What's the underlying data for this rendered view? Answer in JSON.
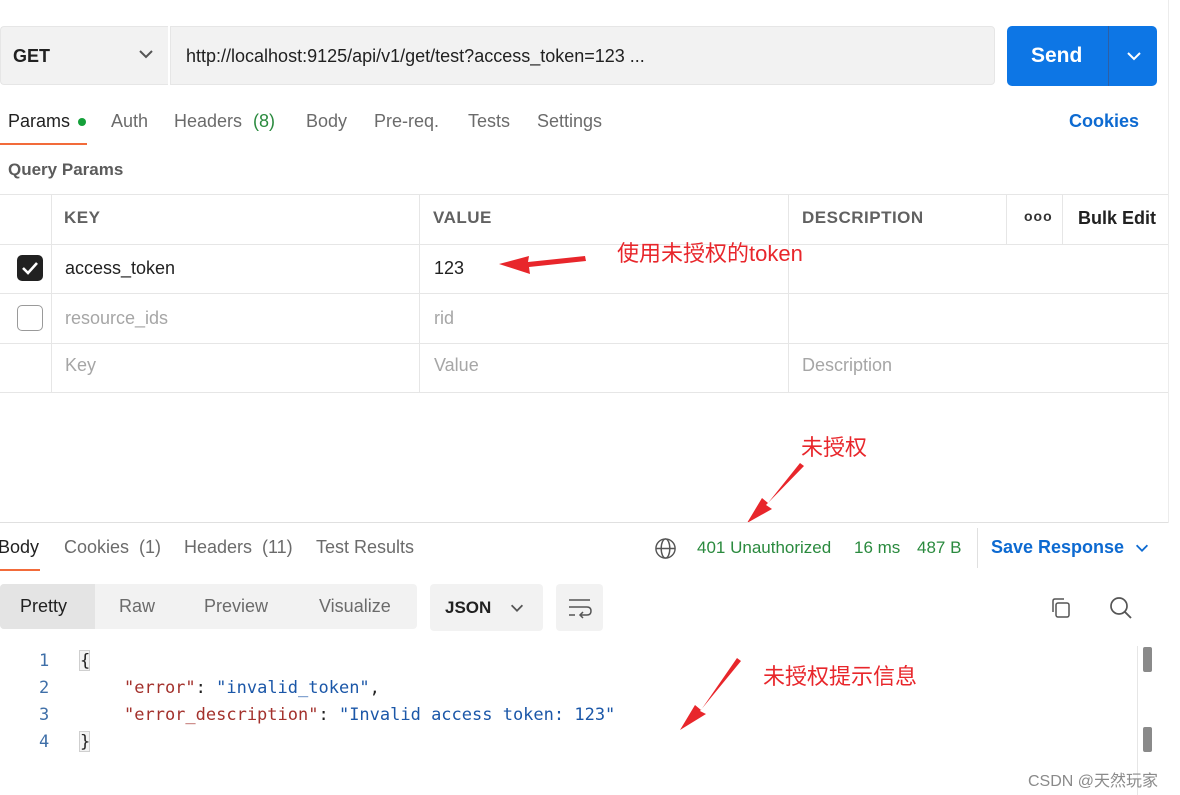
{
  "request": {
    "method": "GET",
    "url": "http://localhost:9125/api/v1/get/test?access_token=123 ...",
    "send_label": "Send"
  },
  "request_tabs": {
    "params": "Params",
    "auth": "Auth",
    "headers": "Headers",
    "headers_count": "(8)",
    "body": "Body",
    "prereq": "Pre-req.",
    "tests": "Tests",
    "settings": "Settings",
    "cookies": "Cookies"
  },
  "query_params": {
    "title": "Query Params",
    "headers": {
      "key": "KEY",
      "value": "VALUE",
      "description": "DESCRIPTION",
      "more": "ooo",
      "bulk_edit": "Bulk Edit"
    },
    "rows": [
      {
        "checked": true,
        "key": "access_token",
        "value": "123",
        "description": ""
      },
      {
        "checked": false,
        "key": "resource_ids",
        "value": "rid",
        "description": ""
      }
    ],
    "placeholder": {
      "key": "Key",
      "value": "Value",
      "description": "Description"
    }
  },
  "annotations": {
    "token": "使用未授权的token",
    "unauthorized": "未授权",
    "message": "未授权提示信息"
  },
  "response_tabs": {
    "body": "Body",
    "cookies": "Cookies",
    "cookies_count": "(1)",
    "headers": "Headers",
    "headers_count": "(11)",
    "test_results": "Test Results"
  },
  "response_status": {
    "status": "401 Unauthorized",
    "time": "16 ms",
    "size": "487 B",
    "save_response": "Save Response"
  },
  "view_modes": {
    "pretty": "Pretty",
    "raw": "Raw",
    "preview": "Preview",
    "visualize": "Visualize",
    "format": "JSON"
  },
  "code": {
    "line_numbers": [
      "1",
      "2",
      "3",
      "4"
    ],
    "open": "{",
    "close": "}",
    "error_key": "\"error\"",
    "error_value": "\"invalid_token\"",
    "desc_key": "\"error_description\"",
    "desc_value": "\"Invalid access token: 123\""
  },
  "watermark": "CSDN @天然玩家",
  "colors": {
    "accent": "#0d76e5",
    "status_green": "#2a8a3e",
    "annotation_red": "#e8262b",
    "tab_active": "#f26b3a"
  }
}
